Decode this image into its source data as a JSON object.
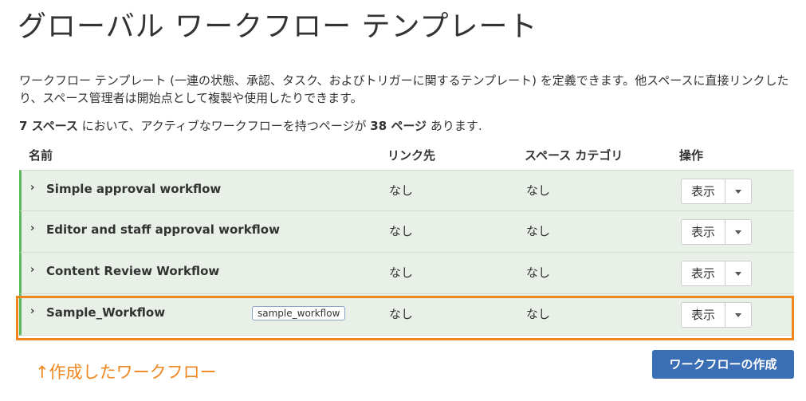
{
  "header": {
    "title": "グローバル ワークフロー テンプレート"
  },
  "description": "ワークフロー テンプレート (一連の状態、承認、タスク、およびトリガーに関するテンプレート) を定義できます。他スペースに直接リンクしたり、スペース管理者は開始点として複製や使用したりできます。",
  "summary": {
    "spaces_count": "7 スペース",
    "text_middle": " において、アクティブなワークフローを持つページが ",
    "pages_count": "38 ページ",
    "text_end": " あります."
  },
  "table": {
    "headers": {
      "name": "名前",
      "link": "リンク先",
      "category": "スペース カテゴリ",
      "operations": "操作"
    },
    "rows": [
      {
        "name": "Simple approval workflow",
        "tag": "",
        "link": "なし",
        "category": "なし",
        "view_label": "表示"
      },
      {
        "name": "Editor and staff approval workflow",
        "tag": "",
        "link": "なし",
        "category": "なし",
        "view_label": "表示"
      },
      {
        "name": "Content Review Workflow",
        "tag": "",
        "link": "なし",
        "category": "なし",
        "view_label": "表示"
      },
      {
        "name": "Sample_Workflow",
        "tag": "sample_workflow",
        "link": "なし",
        "category": "なし",
        "view_label": "表示"
      }
    ]
  },
  "annotation": "↑作成したワークフロー",
  "create_button": "ワークフローの作成",
  "colors": {
    "accent_orange": "#f0871e",
    "primary_blue": "#3a6fb5",
    "row_bg": "#e8f0e8",
    "active_border": "#5cb85c"
  },
  "icons": {
    "row_expand": "chevron-right-icon",
    "dropdown": "caret-down-icon"
  }
}
